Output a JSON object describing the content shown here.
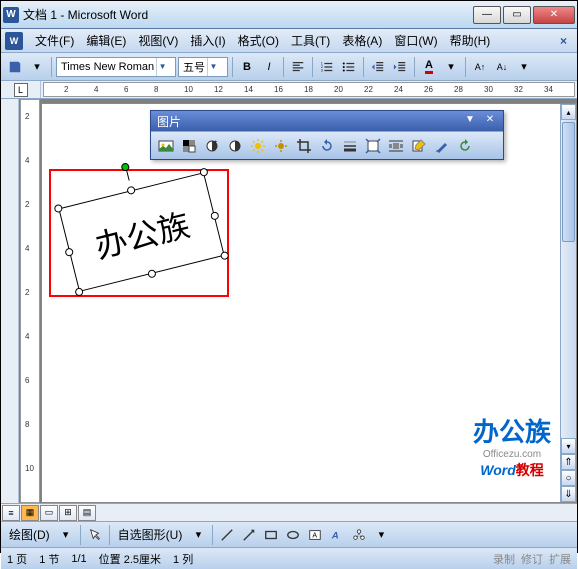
{
  "window": {
    "title": "文档 1 - Microsoft Word"
  },
  "menu": {
    "file": "文件(F)",
    "edit": "编辑(E)",
    "view": "视图(V)",
    "insert": "插入(I)",
    "format": "格式(O)",
    "tools": "工具(T)",
    "table": "表格(A)",
    "window": "窗口(W)",
    "help": "帮助(H)"
  },
  "format_toolbar": {
    "font_name": "Times New Roman",
    "font_size": "五号",
    "bold": "B",
    "italic": "I",
    "font_color_letter": "A",
    "superscript_a1": "A",
    "superscript_a2": "A"
  },
  "ruler": {
    "tab_indicator": "L",
    "h_labels": [
      "2",
      "4",
      "6",
      "8",
      "10",
      "12",
      "14",
      "16",
      "18",
      "20",
      "22",
      "24",
      "26",
      "28",
      "30",
      "32",
      "34"
    ],
    "v_labels": [
      "2",
      "4",
      "2",
      "4",
      "2",
      "4",
      "6",
      "8",
      "10"
    ]
  },
  "picture_toolbar": {
    "title": "图片"
  },
  "selected_object": {
    "text": "办公族"
  },
  "watermark": {
    "line1": "办公族",
    "line2": "Officezu.com",
    "line3_a": "Word",
    "line3_b": "教程"
  },
  "draw_toolbar": {
    "draw_btn": "绘图(D)",
    "autoshapes": "自选图形(U)"
  },
  "status": {
    "page": "1 页",
    "section": "1 节",
    "page_of": "1/1",
    "position": "位置 2.5厘米",
    "column": "1 列",
    "rec": "录制",
    "rev": "修订",
    "ext": "扩展"
  },
  "icons": {
    "min": "—",
    "max": "▭",
    "close": "✕",
    "dropdown": "▼",
    "tb_drop": "▾",
    "help_x": "×",
    "scroll_up": "▴",
    "scroll_down": "▾",
    "nav_up": "⇑",
    "nav_circle": "○",
    "nav_down": "⇓"
  }
}
